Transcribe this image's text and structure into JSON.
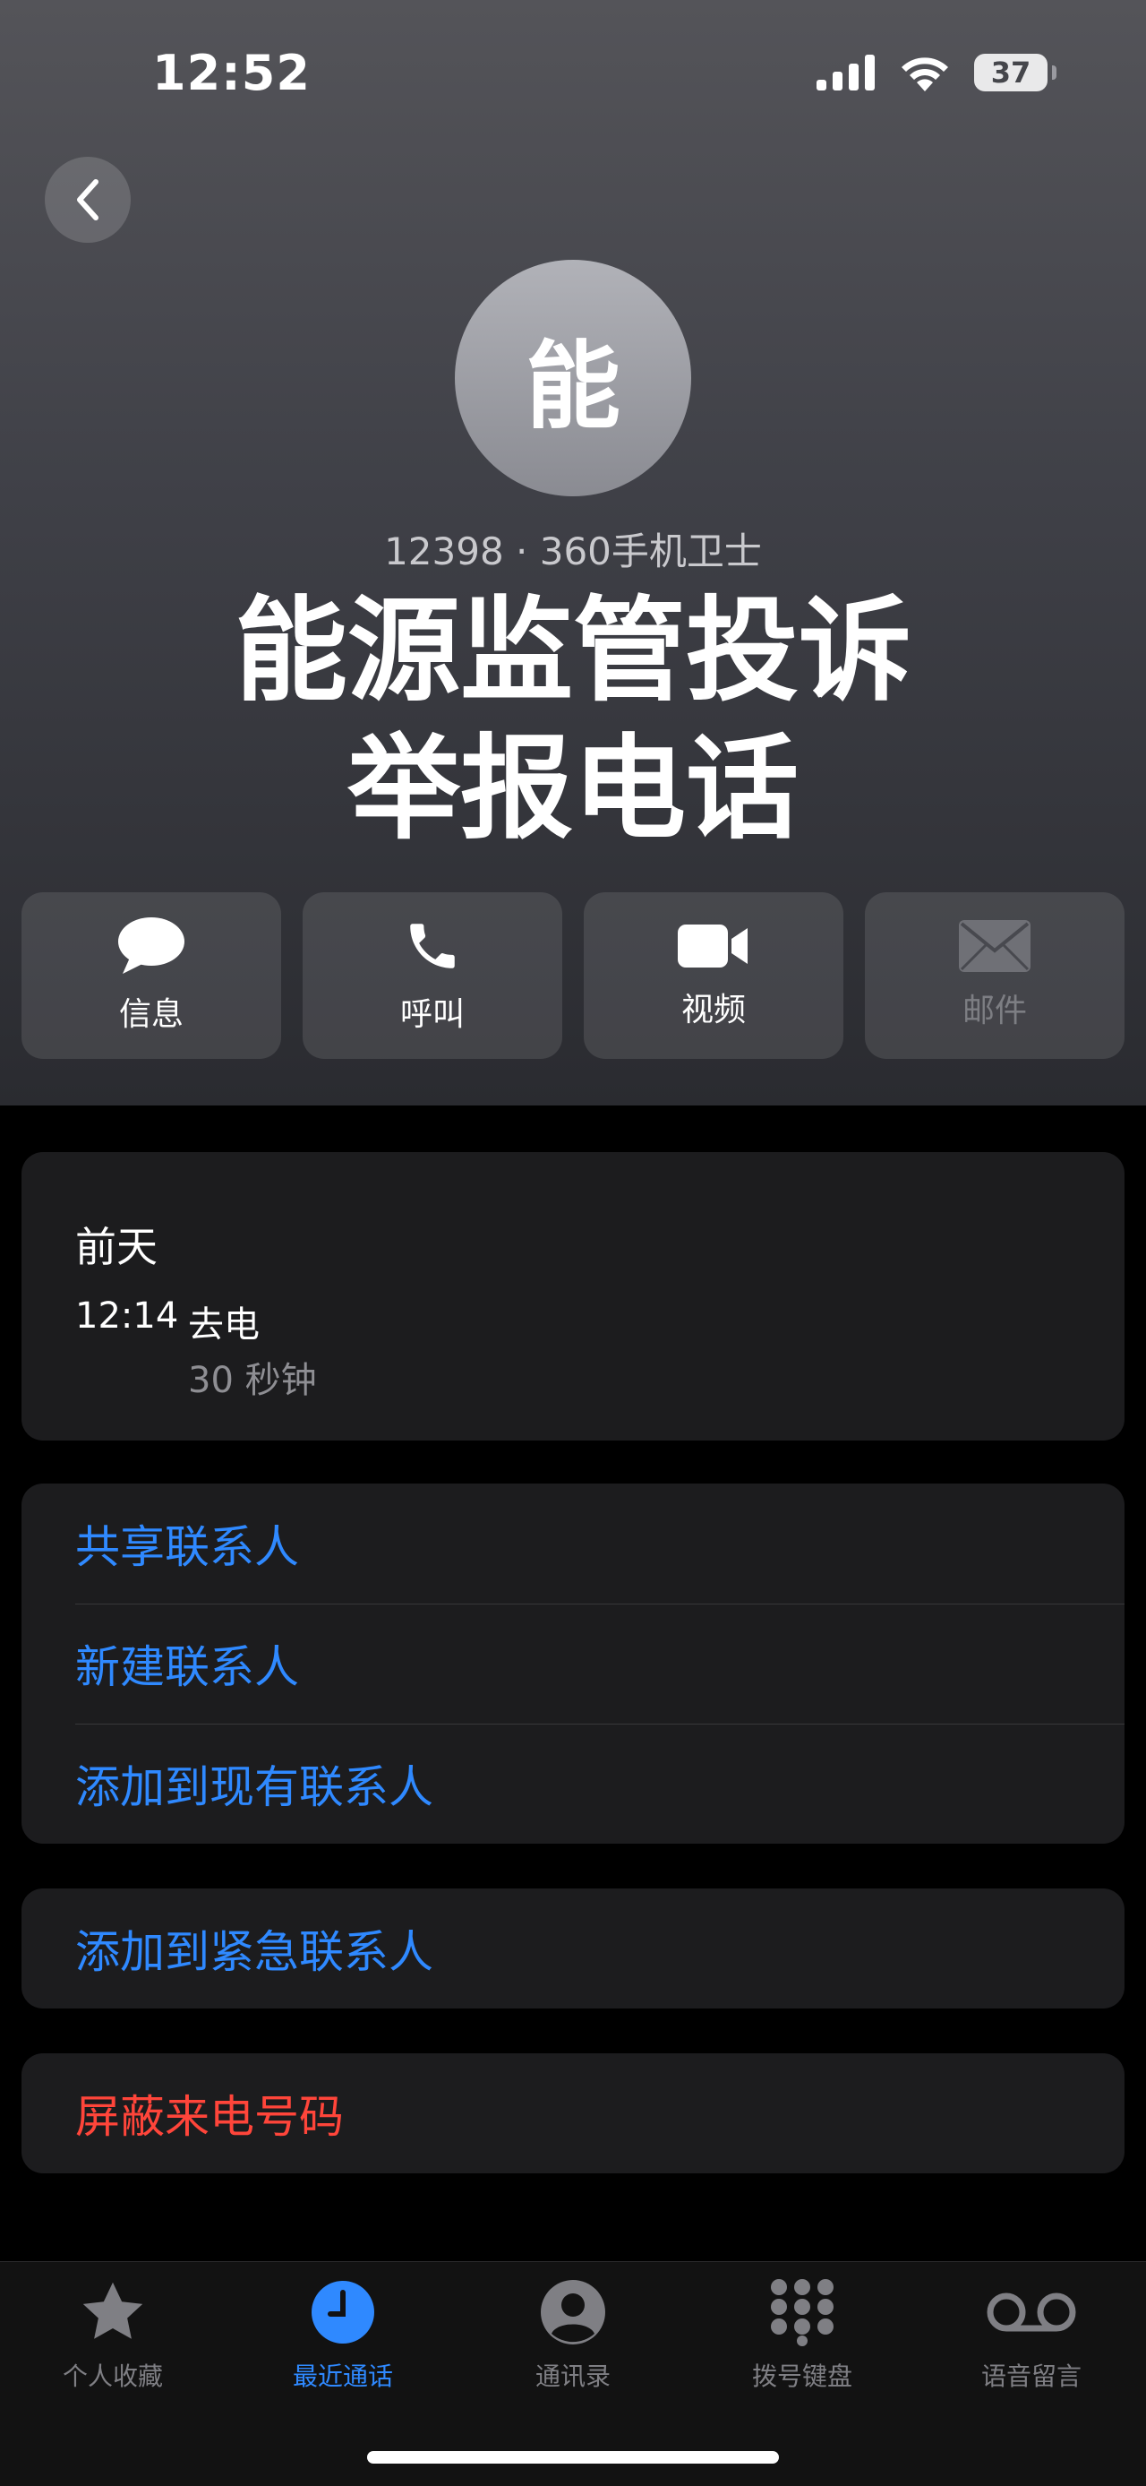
{
  "status_bar": {
    "time": "12:52",
    "battery": "37"
  },
  "contact": {
    "avatar_initial": "能",
    "subtitle": "12398 · 360手机卫士",
    "name_line1": "能源监管投诉",
    "name_line2": "举报电话"
  },
  "actions": [
    {
      "label": "信息",
      "icon": "message-bubble-icon",
      "enabled": true
    },
    {
      "label": "呼叫",
      "icon": "phone-icon",
      "enabled": true
    },
    {
      "label": "视频",
      "icon": "video-camera-icon",
      "enabled": true
    },
    {
      "label": "邮件",
      "icon": "mail-icon",
      "enabled": false
    }
  ],
  "call_history": {
    "day": "前天",
    "time": "12:14",
    "type": "去电",
    "duration": "30 秒钟"
  },
  "options": {
    "share_contact": "共享联系人",
    "new_contact": "新建联系人",
    "add_to_existing": "添加到现有联系人",
    "add_to_emergency": "添加到紧急联系人",
    "block_caller": "屏蔽来电号码"
  },
  "tabbar": [
    {
      "label": "个人收藏",
      "icon": "star-icon",
      "active": false
    },
    {
      "label": "最近通话",
      "icon": "clock-icon",
      "active": true
    },
    {
      "label": "通讯录",
      "icon": "person-circle-icon",
      "active": false
    },
    {
      "label": "拨号键盘",
      "icon": "keypad-icon",
      "active": false
    },
    {
      "label": "语音留言",
      "icon": "voicemail-icon",
      "active": false
    }
  ],
  "colors": {
    "accent": "#2f89ff",
    "destructive": "#ff453a",
    "card": "#1c1c1e"
  }
}
